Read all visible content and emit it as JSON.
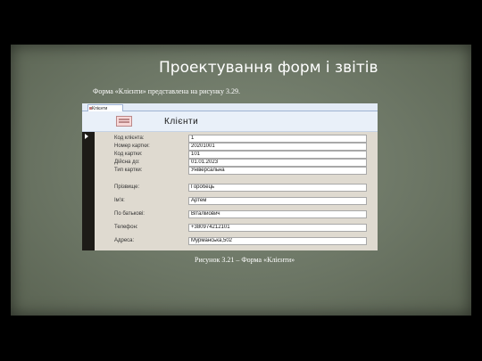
{
  "slide": {
    "title": "Проектування форм і звітів",
    "intro": "Форма «Клієнти» представлена на рисунку 3.29.",
    "caption": "Рисунок 3.21 – Форма «Клієнти»"
  },
  "window": {
    "tab_label": "Клієнти",
    "form_title": "Клієнти",
    "fields": [
      {
        "label": "Код клієнта:",
        "value": "1"
      },
      {
        "label": "Номер картки:",
        "value": "20201001"
      },
      {
        "label": "Код картки:",
        "value": "101"
      },
      {
        "label": "Дійсна до:",
        "value": "01.01.2023"
      },
      {
        "label": "Тип картки:",
        "value": "Універсальна"
      },
      {
        "label": "Прізвище:",
        "value": "Горобець"
      },
      {
        "label": "Ім'я:",
        "value": "Артем"
      },
      {
        "label": "По батькові:",
        "value": "Віталійович"
      },
      {
        "label": "Телефон:",
        "value": "+380974212101"
      },
      {
        "label": "Адреса:",
        "value": "Мурманська,502"
      }
    ]
  }
}
